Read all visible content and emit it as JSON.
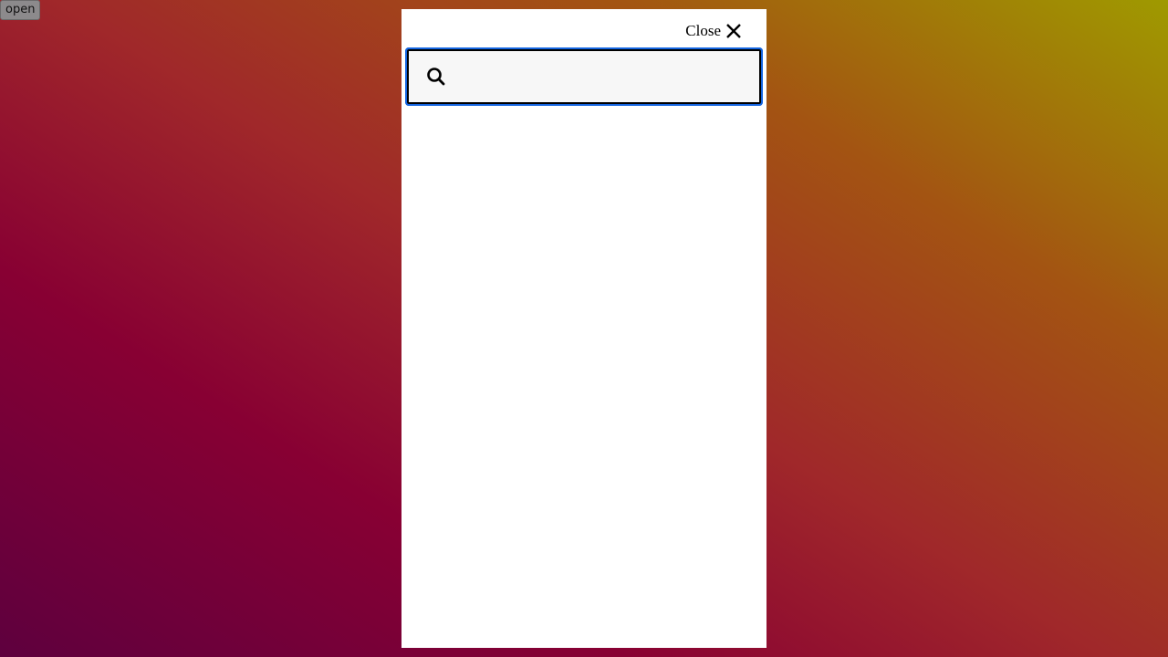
{
  "open_button": {
    "label": "open"
  },
  "search_panel": {
    "close_label": "Close",
    "close_icon": "close-icon",
    "search_icon": "search-icon",
    "search_value": "",
    "search_placeholder": ""
  },
  "colors": {
    "focus_ring": "#1565e0",
    "panel_background": "#ffffff",
    "input_background": "#f7f7f7",
    "backdrop_gradient": [
      "#5e003e",
      "#880033",
      "#a0282a",
      "#a35412",
      "#9f9a00"
    ]
  }
}
